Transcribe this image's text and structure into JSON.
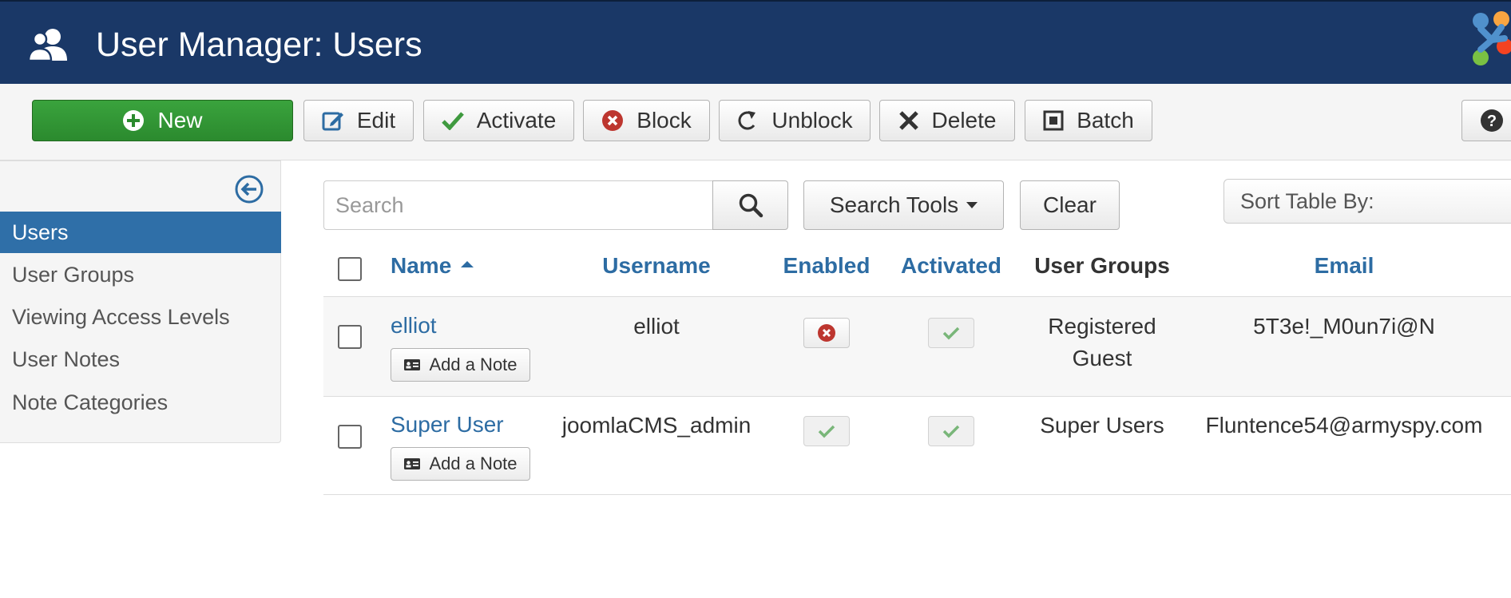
{
  "header": {
    "title": "User Manager: Users",
    "icon": "users-icon",
    "logo": "joomla-logo",
    "color": "#1a3867"
  },
  "toolbar": {
    "buttons": [
      {
        "label": "New",
        "icon": "plus-circle-icon"
      },
      {
        "label": "Edit",
        "icon": "edit-icon"
      },
      {
        "label": "Activate",
        "icon": "check-icon"
      },
      {
        "label": "Block",
        "icon": "x-circle-icon"
      },
      {
        "label": "Unblock",
        "icon": "refresh-icon"
      },
      {
        "label": "Delete",
        "icon": "close-icon"
      },
      {
        "label": "Batch",
        "icon": "batch-icon"
      }
    ],
    "help_icon": "help-icon",
    "new_color": "#2f9632"
  },
  "sidebar": {
    "items": [
      {
        "label": "Users",
        "active": true
      },
      {
        "label": "User Groups",
        "active": false
      },
      {
        "label": "Viewing Access Levels",
        "active": false
      },
      {
        "label": "User Notes",
        "active": false
      },
      {
        "label": "Note Categories",
        "active": false
      }
    ],
    "active_color": "#2f6fa8"
  },
  "filters": {
    "search_placeholder": "Search",
    "search_tools_label": "Search Tools",
    "clear_label": "Clear",
    "sort_label": "Sort Table By:"
  },
  "table": {
    "columns": {
      "name": "Name",
      "username": "Username",
      "enabled": "Enabled",
      "activated": "Activated",
      "groups": "User Groups",
      "email": "Email"
    },
    "sort_column": "Name",
    "rows": [
      {
        "name": "elliot",
        "username": "elliot",
        "enabled": false,
        "activated": true,
        "groups": [
          "Registered",
          "Guest"
        ],
        "email": "5T3e!_M0un7i@N",
        "note_label": "Add a Note"
      },
      {
        "name": "Super User",
        "username": "joomlaCMS_admin",
        "enabled": true,
        "activated": true,
        "groups": [
          "Super Users"
        ],
        "email": "Fluntence54@armyspy.com",
        "note_label": "Add a Note"
      }
    ]
  }
}
